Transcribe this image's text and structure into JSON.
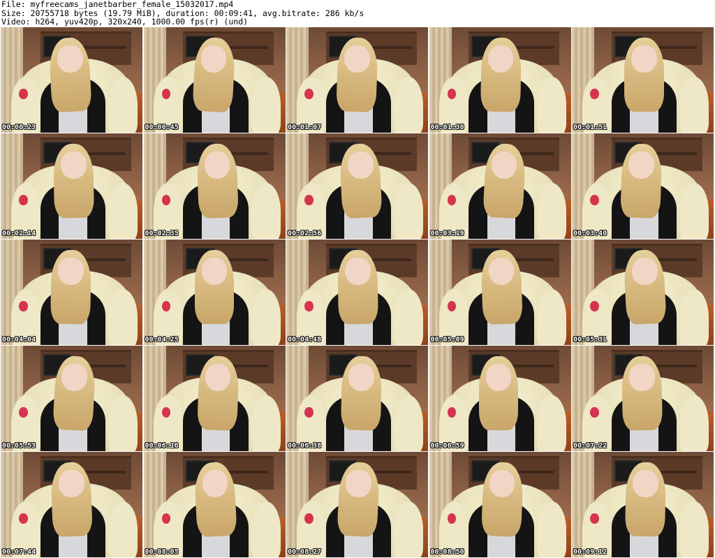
{
  "header": {
    "file_line": "File: myfreecams_janetbarber_female_15032017.mp4",
    "size_line": "Size: 20755718 bytes (19.79 MiB), duration: 00:09:41, avg.bitrate: 286 kb/s",
    "video_line": "Video: h264, yuv420p, 320x240, 1000.00 fps(r) (und)"
  },
  "thumbnails": [
    {
      "timestamp": "00:00:23"
    },
    {
      "timestamp": "00:00:45"
    },
    {
      "timestamp": "00:01:07"
    },
    {
      "timestamp": "00:01:30"
    },
    {
      "timestamp": "00:01:51"
    },
    {
      "timestamp": "00:02:14"
    },
    {
      "timestamp": "00:02:35"
    },
    {
      "timestamp": "00:02:56"
    },
    {
      "timestamp": "00:03:19"
    },
    {
      "timestamp": "00:03:40"
    },
    {
      "timestamp": "00:04:04"
    },
    {
      "timestamp": "00:04:25"
    },
    {
      "timestamp": "00:04:48"
    },
    {
      "timestamp": "00:05:09"
    },
    {
      "timestamp": "00:05:31"
    },
    {
      "timestamp": "00:05:53"
    },
    {
      "timestamp": "00:06:16"
    },
    {
      "timestamp": "00:06:38"
    },
    {
      "timestamp": "00:06:59"
    },
    {
      "timestamp": "00:07:22"
    },
    {
      "timestamp": "00:07:44"
    },
    {
      "timestamp": "00:08:05"
    },
    {
      "timestamp": "00:08:27"
    },
    {
      "timestamp": "00:08:50"
    },
    {
      "timestamp": "00:09:12"
    }
  ]
}
